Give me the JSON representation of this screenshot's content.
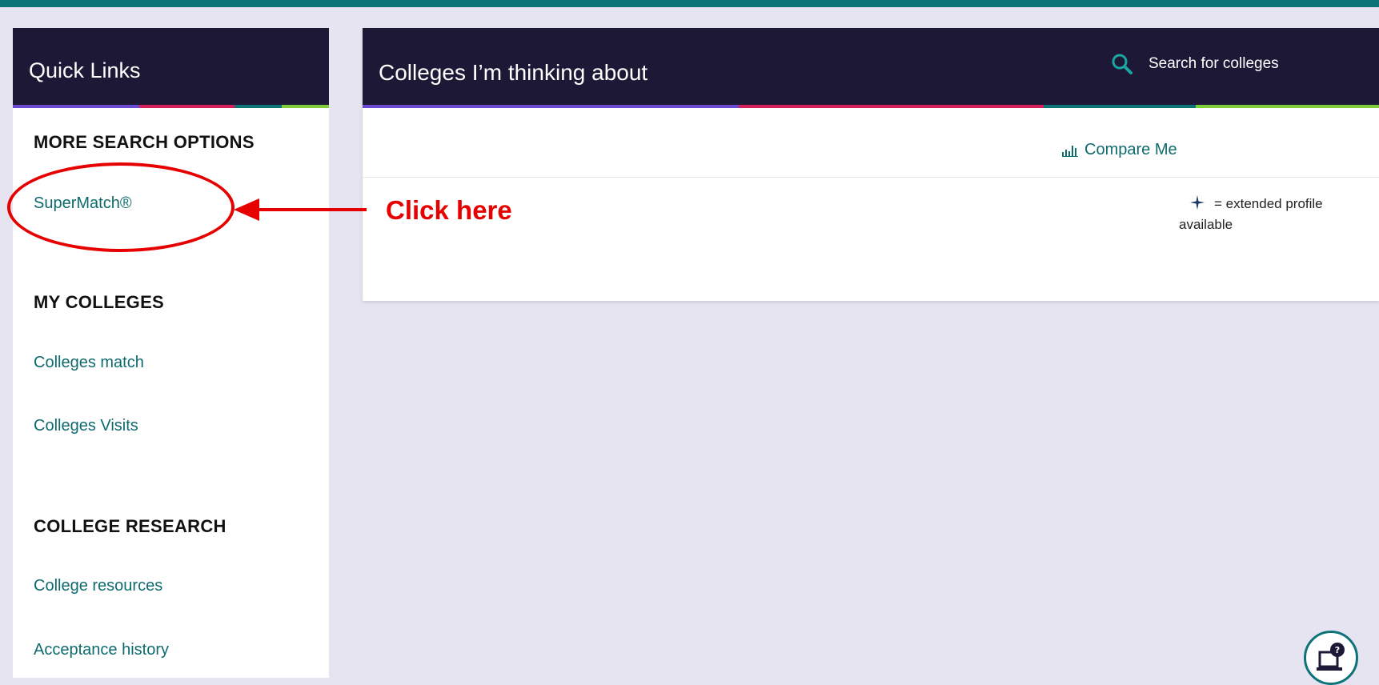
{
  "quick_links": {
    "title": "Quick Links",
    "sections": [
      {
        "heading": "MORE SEARCH OPTIONS",
        "links": [
          "SuperMatch®"
        ]
      },
      {
        "heading": "MY COLLEGES",
        "links": [
          "Colleges match",
          "Colleges Visits"
        ]
      },
      {
        "heading": "COLLEGE RESEARCH",
        "links": [
          "College resources",
          "Acceptance history"
        ]
      }
    ]
  },
  "main_panel": {
    "title": "Colleges I’m thinking about",
    "search_label": "Search for colleges",
    "compare_label": "Compare Me",
    "legend_text": "= extended profile available"
  },
  "annotation": {
    "label": "Click here"
  },
  "icons": {
    "search": "search-icon",
    "compare": "bar-chart-icon",
    "extended_profile": "sparkle-icon",
    "help": "laptop-help-icon"
  },
  "colors": {
    "header_bg": "#1e1837",
    "link": "#0d6b6e",
    "accent_teal": "#0d7378",
    "page_bg": "#e6e4f1",
    "annotation": "#e60000",
    "stripe": [
      "#6a4ad0",
      "#d51f5a",
      "#0d7378",
      "#7ccc3b"
    ]
  }
}
